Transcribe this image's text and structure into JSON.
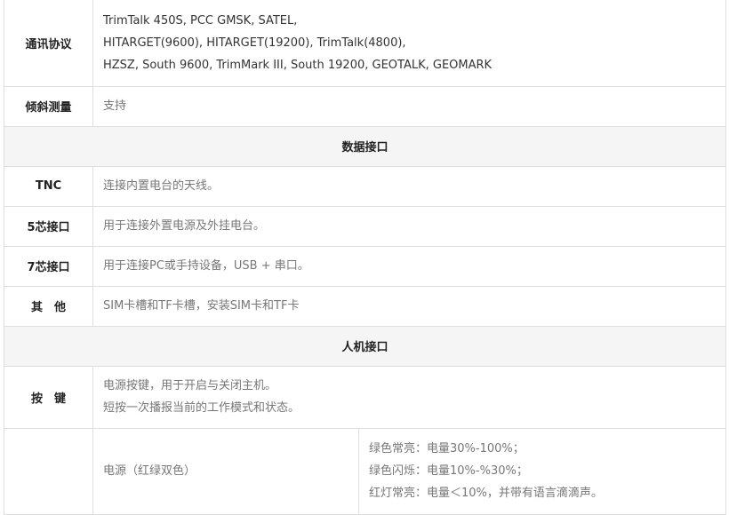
{
  "rows": {
    "protocol": {
      "label": "通讯协议",
      "lines": [
        "TrimTalk 450S, PCC GMSK, SATEL,",
        "HITARGET(9600), HITARGET(19200), TrimTalk(4800),",
        "HZSZ, South 9600, TrimMark III, South 19200, GEOTALK, GEOMARK"
      ]
    },
    "tilt": {
      "label": "倾斜测量",
      "value": "支持"
    },
    "data_interface_header": "数据接口",
    "tnc": {
      "label": "TNC",
      "value": "连接内置电台的天线。"
    },
    "pin5": {
      "label": "5芯接口",
      "value": "用于连接外置电源及外挂电台。"
    },
    "pin7": {
      "label": "7芯接口",
      "value": "用于连接PC或手持设备，USB + 串口。"
    },
    "other": {
      "label": "其　他",
      "value": "SIM卡槽和TF卡槽，安装SIM卡和TF卡"
    },
    "hmi_header": "人机接口",
    "keys": {
      "label": "按　键",
      "lines": [
        "电源按键，用于开启与关闭主机。",
        "短按一次播报当前的工作模式和状态。"
      ]
    },
    "power_led": {
      "label": "",
      "name": "电源（红绿双色）",
      "states": [
        "绿色常亮：电量30%-100%；",
        "绿色闪烁：电量10%-%30%；",
        "红灯常亮：电量＜10%，并带有语言滴滴声。"
      ]
    }
  }
}
